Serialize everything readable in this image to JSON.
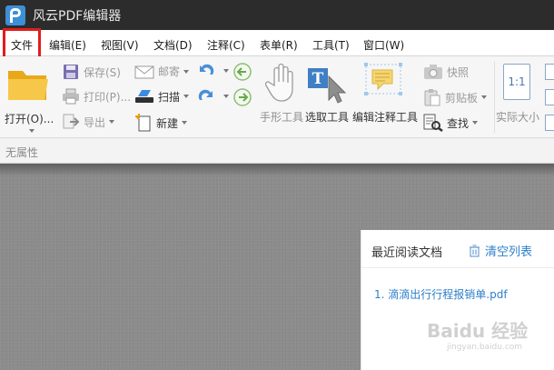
{
  "app": {
    "title": "风云PDF编辑器"
  },
  "menu": [
    "文件",
    "编辑(E)",
    "视图(V)",
    "文档(D)",
    "注释(C)",
    "表单(R)",
    "工具(T)",
    "窗口(W)"
  ],
  "ribbon": {
    "open": "打开(O)...",
    "save": "保存(S)",
    "print": "打印(P)...",
    "export": "导出",
    "mail": "邮寄",
    "scan": "扫描",
    "new": "新建",
    "hand_tool": "手形工具",
    "select_tool": "选取工具",
    "edit_annot_tool": "编辑注释工具",
    "snapshot": "快照",
    "clipboard": "剪贴板",
    "find": "查找",
    "actual_size": "实际大小",
    "actual_size_icon_text": "1:1"
  },
  "props": {
    "label": "无属性"
  },
  "recent": {
    "title": "最近阅读文档",
    "clear": "清空列表",
    "files": [
      "1. 滴滴出行行程报销单.pdf"
    ]
  },
  "watermark": {
    "text": "Baidu 经验",
    "sub": "jingyan.baidu.com"
  },
  "colors": {
    "titlebar": "#2c2c2c",
    "accent": "#2d7fc9",
    "highlight": "#e01e1e",
    "workspace": "#8c8c8c"
  }
}
